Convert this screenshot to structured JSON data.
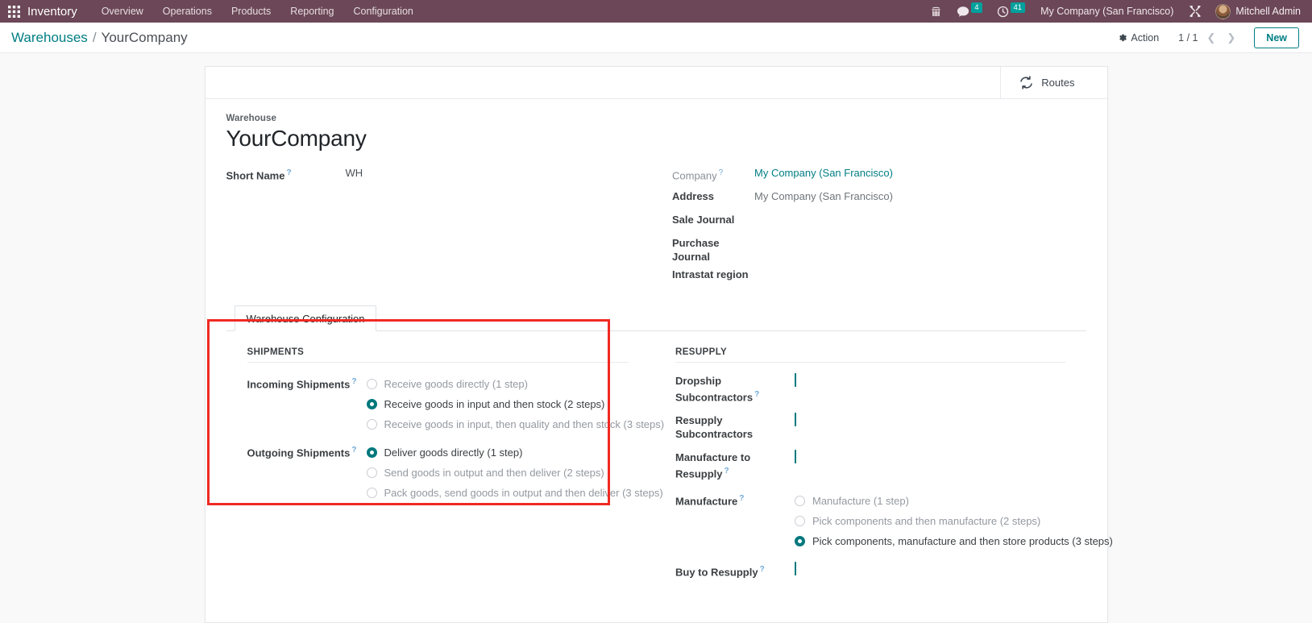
{
  "navbar": {
    "apps_icon": "apps-grid-icon",
    "brand": "Inventory",
    "menu": [
      {
        "label": "Overview"
      },
      {
        "label": "Operations"
      },
      {
        "label": "Products"
      },
      {
        "label": "Reporting"
      },
      {
        "label": "Configuration"
      }
    ],
    "systray": {
      "phone_icon": "phone-icon",
      "messages_icon": "chat-bubble-icon",
      "messages_count": "4",
      "activities_icon": "clock-icon",
      "activities_count": "41",
      "company": "My Company (San Francisco)",
      "tools_icon": "wrench-tools-icon",
      "user_name": "Mitchell Admin",
      "avatar_icon": "user-avatar"
    }
  },
  "control_panel": {
    "breadcrumb_root": "Warehouses",
    "breadcrumb_sep": "/",
    "breadcrumb_current": "YourCompany",
    "action_label": "Action",
    "action_icon": "gear-icon",
    "pager": "1 / 1",
    "prev_icon": "chevron-left-icon",
    "next_icon": "chevron-right-icon",
    "new_label": "New"
  },
  "sheet": {
    "stat_buttons": [
      {
        "label": "Routes",
        "icon": "refresh-cycle-icon"
      }
    ],
    "title_label": "Warehouse",
    "title": "YourCompany",
    "left_fields": [
      {
        "label": "Short Name",
        "help": "?",
        "value": "WH"
      }
    ],
    "right_fields": [
      {
        "label": "Company",
        "help": "?",
        "value": "My Company (San Francisco)",
        "style": "link",
        "label_style": "muted"
      },
      {
        "label": "Address",
        "help": "",
        "value": "My Company (San Francisco)",
        "style": "ghost",
        "label_style": "bold"
      },
      {
        "label": "Sale Journal",
        "help": "",
        "value": "",
        "style": "",
        "label_style": "bold"
      },
      {
        "label": "Purchase Journal",
        "help": "",
        "value": "",
        "style": "",
        "label_style": "bold"
      },
      {
        "label": "Intrastat region",
        "help": "",
        "value": "",
        "style": "",
        "label_style": "bold"
      }
    ],
    "tabs": [
      {
        "label": "Warehouse Configuration",
        "active": true
      }
    ],
    "shipments": {
      "section_title": "SHIPMENTS",
      "incoming": {
        "label": "Incoming Shipments",
        "help": "?",
        "options": [
          {
            "label": "Receive goods directly (1 step)",
            "selected": false
          },
          {
            "label": "Receive goods in input and then stock (2 steps)",
            "selected": true
          },
          {
            "label": "Receive goods in input, then quality and then stock (3 steps)",
            "selected": false
          }
        ]
      },
      "outgoing": {
        "label": "Outgoing Shipments",
        "help": "?",
        "options": [
          {
            "label": "Deliver goods directly (1 step)",
            "selected": true
          },
          {
            "label": "Send goods in output and then deliver (2 steps)",
            "selected": false
          },
          {
            "label": "Pack goods, send goods in output and then deliver (3 steps)",
            "selected": false
          }
        ]
      }
    },
    "resupply": {
      "section_title": "RESUPPLY",
      "dropship_subcontractors": {
        "label": "Dropship Subcontractors",
        "help": "?",
        "checked": true
      },
      "resupply_subcontractors": {
        "label": "Resupply Subcontractors",
        "help": "",
        "checked": true
      },
      "manufacture_to_resupply": {
        "label": "Manufacture to Resupply",
        "help": "?",
        "checked": true
      },
      "manufacture": {
        "label": "Manufacture",
        "help": "?",
        "options": [
          {
            "label": "Manufacture (1 step)",
            "selected": false
          },
          {
            "label": "Pick components and then manufacture (2 steps)",
            "selected": false
          },
          {
            "label": "Pick components, manufacture and then store products (3 steps)",
            "selected": true
          }
        ]
      },
      "buy_to_resupply": {
        "label": "Buy to Resupply",
        "help": "?",
        "checked": true
      }
    }
  },
  "annotation": {
    "color": "#ef2a23",
    "target": "shipments-section"
  }
}
